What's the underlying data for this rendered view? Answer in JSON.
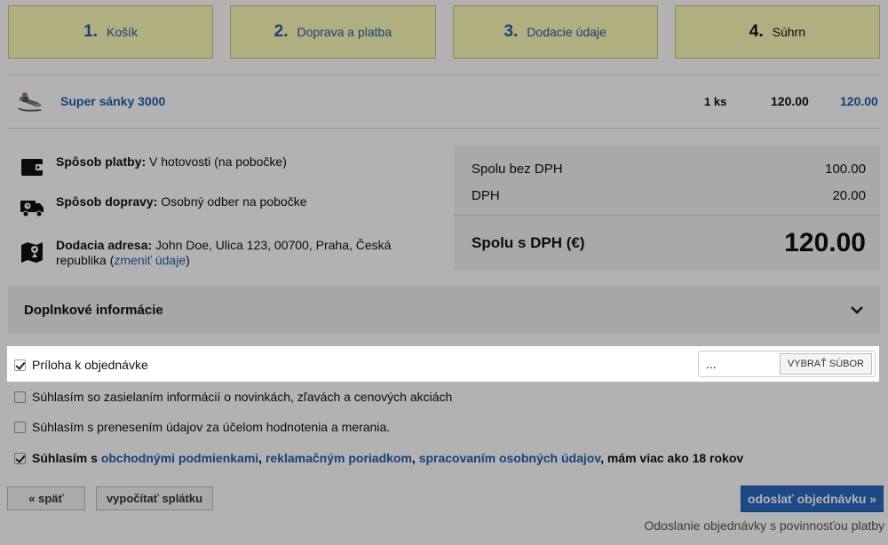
{
  "steps": [
    {
      "num": "1.",
      "label": "Košík"
    },
    {
      "num": "2.",
      "label": "Doprava a platba"
    },
    {
      "num": "3.",
      "label": "Dodacie údaje"
    },
    {
      "num": "4.",
      "label": "Súhrn"
    }
  ],
  "product": {
    "name": "Super sánky 3000",
    "qty": "1 ks",
    "price": "120.00",
    "total": "120.00"
  },
  "info": {
    "payment_label": "Spôsob platby:",
    "payment_value": " V hotovosti (na pobočke)",
    "shipping_label": "Spôsob dopravy:",
    "shipping_value": " Osobný odber na pobočke",
    "address_label": "Dodacia adresa:",
    "address_value": " John Doe, Ulica 123, 00700, Praha, Česká republika (",
    "address_link": "zmeniť údaje",
    "address_close": ")"
  },
  "summary": {
    "without_vat_label": "Spolu bez DPH",
    "without_vat_value": "100.00",
    "vat_label": "DPH",
    "vat_value": "20.00",
    "total_label": "Spolu s DPH (€)",
    "total_value": "120.00"
  },
  "accordion": {
    "title": "Doplnkové informácie"
  },
  "attachment": {
    "label": "Príloha k objednávke",
    "file_value": "...",
    "choose_button": "VYBRAŤ SÚBOR"
  },
  "consents": {
    "newsletter": "Súhlasím so zasielaním informácií o novinkách, zľavách a cenových akciách",
    "tracking": "Súhlasím s prenesením údajov za účelom hodnotenia a merania.",
    "terms_prefix": "Súhlasím s ",
    "terms_link1": "obchodnými podmienkami",
    "terms_sep1": ", ",
    "terms_link2": "reklamačným poriadkom",
    "terms_sep2": ", ",
    "terms_link3": "spracovaním osobných údajov",
    "terms_suffix": ", mám viac ako 18 rokov"
  },
  "buttons": {
    "back": "« späť",
    "installment": "vypočítať splátku",
    "submit": "odoslať objednávku »"
  },
  "note": "Odoslanie objednávky s povinnosťou platby",
  "colors": {
    "accent": "#2a69c2",
    "link": "#1d5fae",
    "step_bg": "#fdfbb8"
  }
}
